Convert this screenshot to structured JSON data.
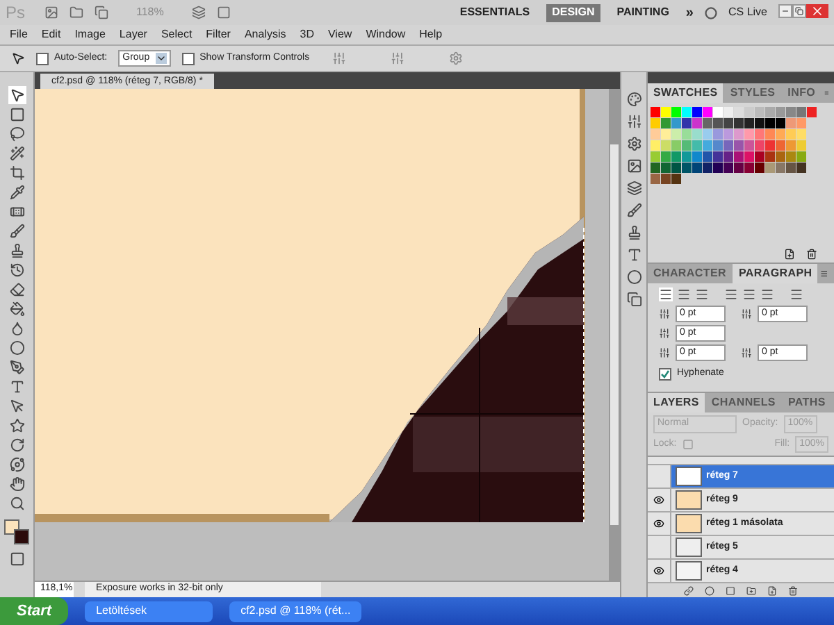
{
  "app_bar": {
    "logo": "Ps",
    "zoom": "118%",
    "workspaces": [
      {
        "label": "ESSENTIALS",
        "selected": false
      },
      {
        "label": "DESIGN",
        "selected": true
      },
      {
        "label": "PAINTING",
        "selected": false
      }
    ],
    "more": "»",
    "cs_live": "CS Live"
  },
  "menu": [
    "File",
    "Edit",
    "Image",
    "Layer",
    "Select",
    "Filter",
    "Analysis",
    "3D",
    "View",
    "Window",
    "Help"
  ],
  "options_bar": {
    "auto_select": {
      "label": "Auto-Select:",
      "checked": false
    },
    "auto_select_target": "Group",
    "transform_controls": {
      "label": "Show Transform Controls",
      "checked": false
    }
  },
  "tools": [
    {
      "kind": "move",
      "selected": true
    },
    {
      "kind": "marquee",
      "selected": false
    },
    {
      "kind": "lasso",
      "selected": false
    },
    {
      "kind": "wand",
      "selected": false
    },
    {
      "kind": "crop",
      "selected": false
    },
    {
      "kind": "eyedropper",
      "selected": false
    },
    {
      "kind": "healing",
      "selected": false
    },
    {
      "kind": "brush",
      "selected": false
    },
    {
      "kind": "stamp",
      "selected": false
    },
    {
      "kind": "history",
      "selected": false
    },
    {
      "kind": "eraser",
      "selected": false
    },
    {
      "kind": "bucket",
      "selected": false
    },
    {
      "kind": "blur",
      "selected": false
    },
    {
      "kind": "dodge",
      "selected": false
    },
    {
      "kind": "pen",
      "selected": false
    },
    {
      "kind": "type",
      "selected": false
    },
    {
      "kind": "path",
      "selected": false
    },
    {
      "kind": "shape",
      "selected": false
    },
    {
      "kind": "rotate",
      "selected": false
    },
    {
      "kind": "orbit",
      "selected": false
    },
    {
      "kind": "hand",
      "selected": false
    },
    {
      "kind": "zoom",
      "selected": false
    }
  ],
  "document": {
    "tab": "cf2.psd @ 118% (réteg 7, RGB/8) *"
  },
  "status_bar": {
    "zoom": "118,1%",
    "message": "Exposure works in 32-bit only"
  },
  "swatches_panel": {
    "tabs": [
      {
        "label": "SWATCHES",
        "selected": true
      },
      {
        "label": "STYLES",
        "selected": false
      },
      {
        "label": "INFO",
        "selected": false
      }
    ]
  },
  "paragraph_panel": {
    "tabs": [
      {
        "label": "CHARACTER",
        "selected": false
      },
      {
        "label": "PARAGRAPH",
        "selected": true
      }
    ],
    "fields": [
      "0 pt",
      "0 pt",
      "0 pt",
      "0 pt",
      "0 pt"
    ],
    "hyphenate": {
      "label": "Hyphenate",
      "checked": true
    }
  },
  "layers_panel": {
    "tabs": [
      {
        "label": "LAYERS",
        "selected": true
      },
      {
        "label": "CHANNELS",
        "selected": false
      },
      {
        "label": "PATHS",
        "selected": false
      }
    ],
    "blend_mode": "Normal",
    "opacity_label": "Opacity:",
    "opacity": "100%",
    "lock_label": "Lock:",
    "fill_label": "Fill:",
    "fill": "100%",
    "layers": [
      {
        "name": "réteg 7",
        "visible": false,
        "selected": true,
        "kind": "figure"
      },
      {
        "name": "réteg 9",
        "visible": true,
        "selected": false,
        "kind": "beige"
      },
      {
        "name": "réteg 1 másolata",
        "visible": true,
        "selected": false,
        "kind": "beige"
      },
      {
        "name": "réteg 5",
        "visible": false,
        "selected": false,
        "kind": "stroke"
      },
      {
        "name": "réteg 4",
        "visible": true,
        "selected": false,
        "kind": "faint"
      }
    ]
  },
  "taskbar": {
    "start": "Start",
    "items": [
      "Letöltések",
      "cf2.psd @ 118% (rét..."
    ]
  }
}
